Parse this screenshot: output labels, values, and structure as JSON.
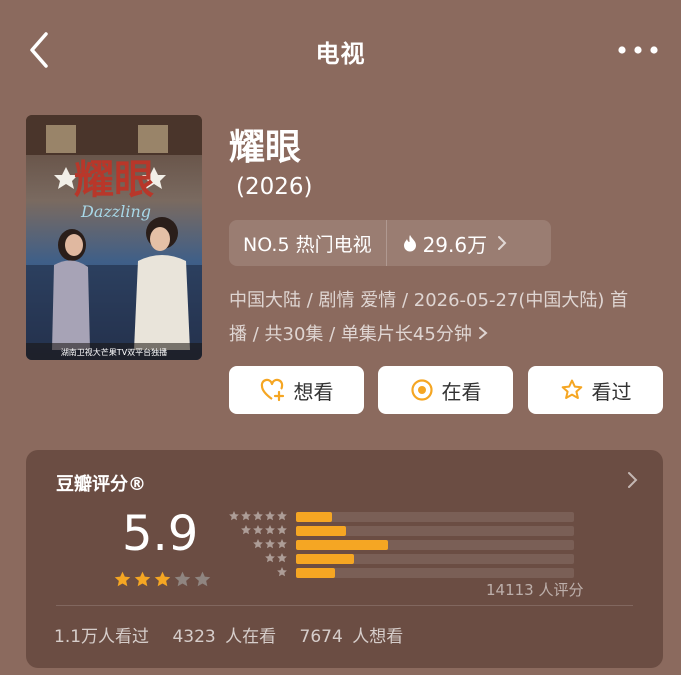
{
  "nav": {
    "title": "电视"
  },
  "poster": {
    "title_art": "耀眼",
    "english_title": "Dazzling",
    "caption": "湖南卫视大芒果TV双平台独播"
  },
  "show": {
    "title": "耀眼",
    "year": "(2026)",
    "rank": "NO.5 热门电视",
    "heat": "29.6万",
    "meta_line1": "中国大陆 / 剧情 爱情 / 2026-05-27(中国大陆) 首",
    "meta_line2": "播 / 共30集 / 单集片长45分钟"
  },
  "actions": {
    "want": "想看",
    "watching": "在看",
    "watched": "看过"
  },
  "rating": {
    "header": "豆瓣评分®",
    "score": "5.9",
    "star_fill": 3,
    "distribution": [
      0.13,
      0.18,
      0.33,
      0.21,
      0.14
    ],
    "count": "14113 人评分",
    "watched": "1.1万人看过",
    "watching": "4323 人在看",
    "want": "7674 人想看"
  },
  "colors": {
    "background": "#8b6a5e",
    "accent": "#f5a623",
    "star_empty": "#8f8580"
  }
}
